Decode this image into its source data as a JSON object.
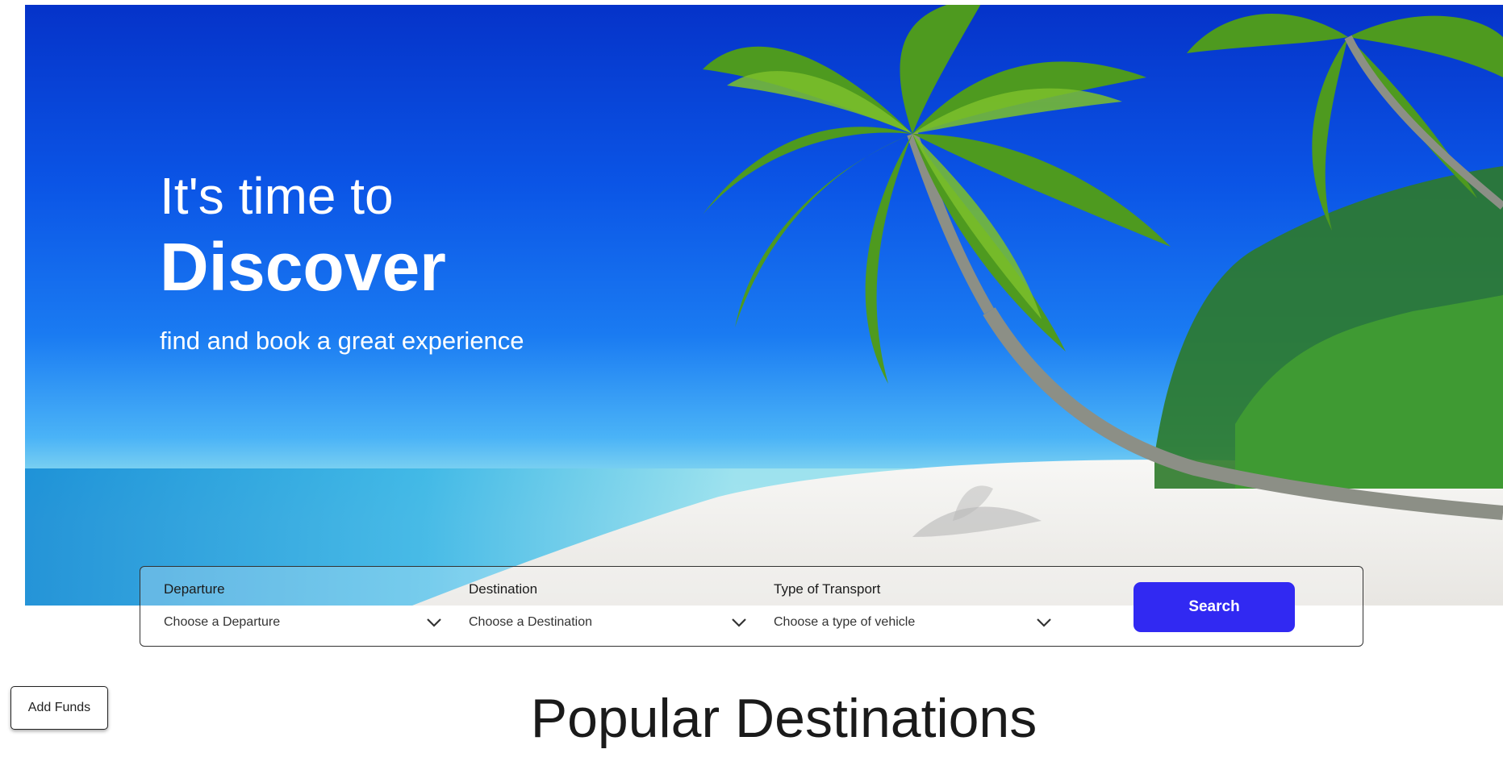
{
  "hero": {
    "line1": "It's time to",
    "line2": "Discover",
    "line3": "find and book a great experience"
  },
  "search": {
    "departure": {
      "label": "Departure",
      "value": "Choose a Departure"
    },
    "destination": {
      "label": "Destination",
      "value": "Choose a Destination"
    },
    "transport": {
      "label": "Type of Transport",
      "value": "Choose a type of vehicle"
    },
    "button_label": "Search"
  },
  "funds_button": "Add Funds",
  "section": {
    "title": "Popular Destinations"
  },
  "colors": {
    "accent": "#3129f2",
    "sky": "#0b55e6",
    "sand": "#f4f4f2"
  },
  "icons": {
    "chevron": "chevron-down-icon"
  }
}
